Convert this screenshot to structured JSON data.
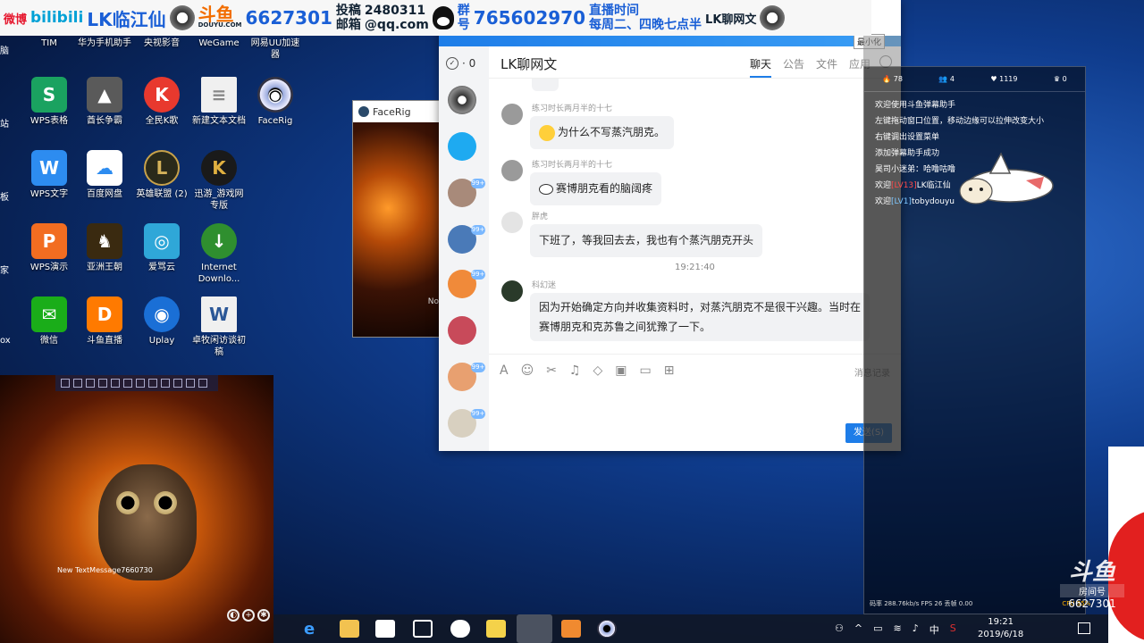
{
  "banner": {
    "weibo": "微博",
    "bilibili": "bilibili",
    "name": "LK临江仙",
    "douyu": "斗鱼",
    "douyu_url": "DOUYU.COM",
    "room": "6627301",
    "submit1": "投稿",
    "submit2": "邮箱",
    "qq_num": "2480311",
    "qq_mail": "@qq.com",
    "group1": "群",
    "group2": "号",
    "group_num": "765602970",
    "live_time1": "直播时间",
    "live_time2": "每周二、四晚七点半",
    "chat_name": "LK聊网文"
  },
  "desktop": {
    "col_partial": [
      "脑",
      "站",
      "板",
      "家",
      "ox"
    ],
    "icons": [
      {
        "label": "TIM",
        "color": "#1e7de8",
        "glyph": "T"
      },
      {
        "label": "华为手机助手",
        "color": "#e02020",
        "glyph": "H"
      },
      {
        "label": "央视影音",
        "color": "#d62828",
        "glyph": "▶"
      },
      {
        "label": "WeGame",
        "color": "#333333",
        "glyph": "W"
      },
      {
        "label": "网易UU加速器",
        "color": "#19a0e6",
        "glyph": "U"
      },
      {
        "label": "WPS表格",
        "color": "#1aa260",
        "glyph": "S"
      },
      {
        "label": "酋长争霸",
        "color": "#5a5a5a",
        "glyph": "▲"
      },
      {
        "label": "全民K歌",
        "color": "#e8392e",
        "glyph": "K"
      },
      {
        "label": "新建文本文档",
        "color": "#f0f0f0",
        "glyph": "≡"
      },
      {
        "label": "FaceRig",
        "color": "#1c2a38",
        "glyph": "◉"
      },
      {
        "label": "WPS文字",
        "color": "#2d8cf0",
        "glyph": "W"
      },
      {
        "label": "百度网盘",
        "color": "#ffffff",
        "glyph": "☁"
      },
      {
        "label": "英雄联盟 (2)",
        "color": "#2a2a1a",
        "glyph": "L"
      },
      {
        "label": "迅游_游戏网专版",
        "color": "#1a1a1a",
        "glyph": "K"
      },
      {
        "label": "WPS演示",
        "color": "#f26d21",
        "glyph": "P"
      },
      {
        "label": "亚洲王朝",
        "color": "#3a2a10",
        "glyph": "♞"
      },
      {
        "label": "爱骂云",
        "color": "#2fa7d8",
        "glyph": "◎"
      },
      {
        "label": "Internet Downlo...",
        "color": "#2f8f2f",
        "glyph": "↓"
      },
      {
        "label": "微信",
        "color": "#1aad19",
        "glyph": "✉"
      },
      {
        "label": "斗鱼直播",
        "color": "#ff7a00",
        "glyph": "D"
      },
      {
        "label": "Uplay",
        "color": "#1a6fd6",
        "glyph": "◉"
      },
      {
        "label": "卓牧闲访谈初稿",
        "color": "#f0f0f0",
        "glyph": "W"
      }
    ]
  },
  "facerig": {
    "title": "FaceRig",
    "side_text": "No"
  },
  "catvideo": {
    "caption": "New TextMessage7660730"
  },
  "chat": {
    "minimize_tip": "最小化",
    "check_count": "· 0",
    "group_name": "LK聊网文",
    "tabs": [
      "聊天",
      "公告",
      "文件",
      "应用"
    ],
    "badges": [
      "99+",
      "99+",
      "99+",
      "99+",
      "99+"
    ],
    "messages": [
      {
        "sender": "练习时长两月半的十七",
        "text": "为什么不写蒸汽朋克。"
      },
      {
        "sender": "练习时长两月半的十七",
        "text": "赛博朋克看的脑阔疼"
      },
      {
        "sender": "胖虎",
        "text": "下班了，等我回去去，我也有个蒸汽朋克开头"
      },
      {
        "sender": "科幻迷",
        "text_line1": "因为开始确定方向并收集资料时，对蒸汽朋克不是很干兴趣。当时在",
        "text_line2": "赛博朋克和克苏鲁之间犹豫了一下。"
      }
    ],
    "timestamp": "19:21:40",
    "history": "消息记录",
    "send": "发送(S)"
  },
  "danmu": {
    "stats": [
      "78",
      "4",
      "1119",
      "0"
    ],
    "lines": [
      {
        "plain": "欢迎使用斗鱼弹幕助手"
      },
      {
        "plain": "左键拖动窗口位置，移动边缘可以拉伸改变大小"
      },
      {
        "plain": "右键调出设置菜单"
      },
      {
        "plain": "添加弹幕助手成功"
      },
      {
        "plain": "昊司小迷弟：哈噜咕噜"
      },
      {
        "pre": "欢迎",
        "hl": "[LV13]",
        "post": "LK临江仙"
      },
      {
        "pre": "欢迎",
        "lv": "[LV1]",
        "post": "tobydouyu"
      }
    ],
    "status": "码率 288.76kb/s FPS 26 丢帧 0.00",
    "cpu": "CPU 35%"
  },
  "taskbar": {
    "ime": "中",
    "time": "19:21",
    "date": "2019/6/18"
  },
  "watermark": {
    "logo": "斗鱼",
    "sub": "房间号",
    "room": "6627301"
  }
}
